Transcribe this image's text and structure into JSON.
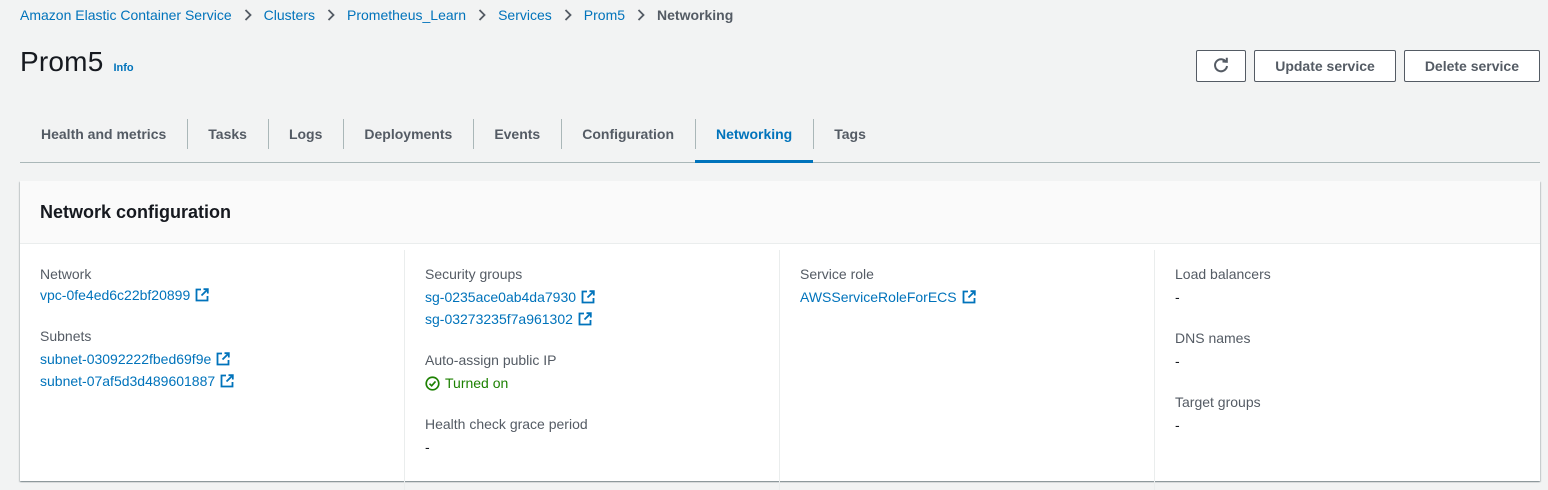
{
  "breadcrumb": [
    {
      "label": "Amazon Elastic Container Service"
    },
    {
      "label": "Clusters"
    },
    {
      "label": "Prometheus_Learn"
    },
    {
      "label": "Services"
    },
    {
      "label": "Prom5"
    },
    {
      "label": "Networking"
    }
  ],
  "header": {
    "title": "Prom5",
    "info": "Info",
    "update_label": "Update service",
    "delete_label": "Delete service"
  },
  "tabs": [
    {
      "label": "Health and metrics"
    },
    {
      "label": "Tasks"
    },
    {
      "label": "Logs"
    },
    {
      "label": "Deployments"
    },
    {
      "label": "Events"
    },
    {
      "label": "Configuration"
    },
    {
      "label": "Networking",
      "active": true
    },
    {
      "label": "Tags"
    }
  ],
  "panel": {
    "title": "Network configuration",
    "network": {
      "label": "Network",
      "value": "vpc-0fe4ed6c22bf20899"
    },
    "subnets": {
      "label": "Subnets",
      "values": [
        "subnet-03092222fbed69f9e",
        "subnet-07af5d3d489601887"
      ]
    },
    "security_groups": {
      "label": "Security groups",
      "values": [
        "sg-0235ace0ab4da7930",
        "sg-03273235f7a961302"
      ]
    },
    "auto_assign": {
      "label": "Auto-assign public IP",
      "value": "Turned on"
    },
    "grace_period": {
      "label": "Health check grace period",
      "value": "-"
    },
    "service_role": {
      "label": "Service role",
      "value": "AWSServiceRoleForECS"
    },
    "load_balancers": {
      "label": "Load balancers",
      "value": "-"
    },
    "dns_names": {
      "label": "DNS names",
      "value": "-"
    },
    "target_groups": {
      "label": "Target groups",
      "value": "-"
    }
  },
  "colors": {
    "link": "#0073bb",
    "success": "#1d8102",
    "text": "#16191f",
    "muted": "#545b64",
    "background": "#f2f3f3"
  },
  "icons": {
    "refresh": "refresh-icon",
    "external": "external-link-icon",
    "status": "status-success-icon",
    "separator": "chevron-right-icon"
  }
}
